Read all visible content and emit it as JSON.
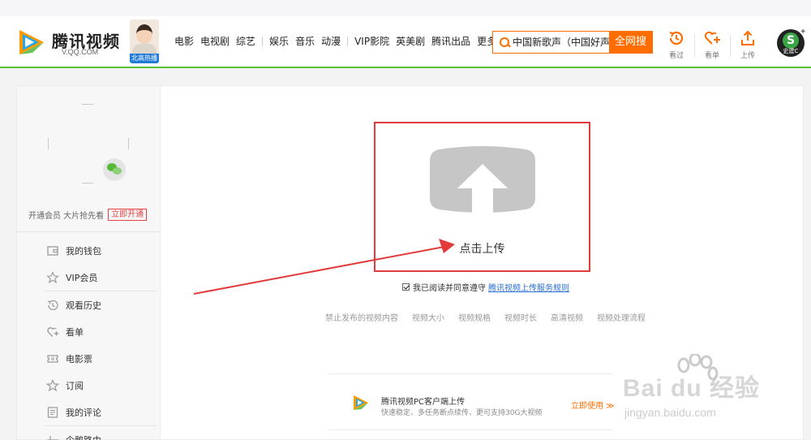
{
  "header": {
    "logo_name": "腾讯视频",
    "logo_domain": "V.QQ.COM",
    "promo_tag": "北高热播",
    "nav": [
      "电影",
      "电视剧",
      "综艺",
      "娱乐",
      "音乐",
      "动漫",
      "VIP影院",
      "英美剧",
      "腾讯出品",
      "更多"
    ],
    "search": {
      "value": "中国新歌声（中国好声",
      "button": "全网搜"
    },
    "actions": [
      {
        "label": "看过",
        "icon": "history-icon"
      },
      {
        "label": "看单",
        "icon": "heart-plus-icon"
      },
      {
        "label": "上传",
        "icon": "upload-icon"
      }
    ],
    "avatar_text": "S",
    "avatar_caption": "史建C"
  },
  "sidebar": {
    "vip_text": "开通会员 大片抢先看",
    "vip_button": "立即开通",
    "menu": [
      {
        "label": "我的钱包",
        "icon": "wallet-icon"
      },
      {
        "label": "VIP会员",
        "icon": "star-outline-icon"
      },
      {
        "label": "观看历史",
        "icon": "clock-icon"
      },
      {
        "label": "看单",
        "icon": "heart-plus-icon"
      },
      {
        "label": "电影票",
        "icon": "ticket-icon"
      },
      {
        "label": "订阅",
        "icon": "star-icon"
      },
      {
        "label": "我的评论",
        "icon": "comment-icon"
      },
      {
        "label": "企鹅路由",
        "icon": "router-icon"
      }
    ]
  },
  "main": {
    "upload_label": "点击上传",
    "agree_text": "我已阅读并同意遵守",
    "agree_link": "腾讯视频上传服务规则",
    "rules": [
      "禁止发布的视频内容",
      "视频大小",
      "视频规格",
      "视频时长",
      "高清视频",
      "视频处理流程"
    ],
    "client": {
      "title": "腾讯视频PC客户端上传",
      "desc": "快速稳定、多任务断点续传、更可支持30G大视频",
      "action": "立即使用 ≫"
    }
  },
  "watermark": {
    "brand": "Bai du 经验",
    "url": "jingyan.baidu.com"
  },
  "colors": {
    "accent": "#ff6d00",
    "green": "#5cbf34",
    "annotation": "#e23b3b",
    "link": "#2a6fd1"
  }
}
